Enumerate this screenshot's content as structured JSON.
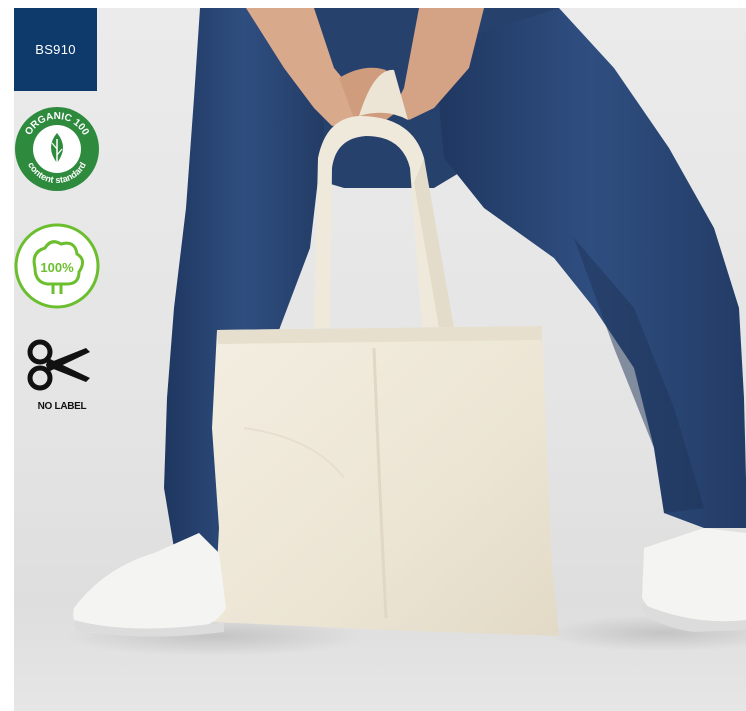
{
  "product": {
    "code": "BS910"
  },
  "badges": {
    "organic": {
      "top_text": "ORGANIC 100",
      "bottom_text": "content standard",
      "icon": "leaf-icon",
      "color": "#2e8b3e"
    },
    "cotton": {
      "text": "100%",
      "icon": "cotton-boll-icon",
      "color": "#6bbf2f"
    },
    "no_label": {
      "text": "NO LABEL",
      "icon": "scissors-icon"
    }
  },
  "colors": {
    "code_badge_bg": "#0d3a6b",
    "denim": "#2a4570",
    "bag": "#efe9da"
  }
}
